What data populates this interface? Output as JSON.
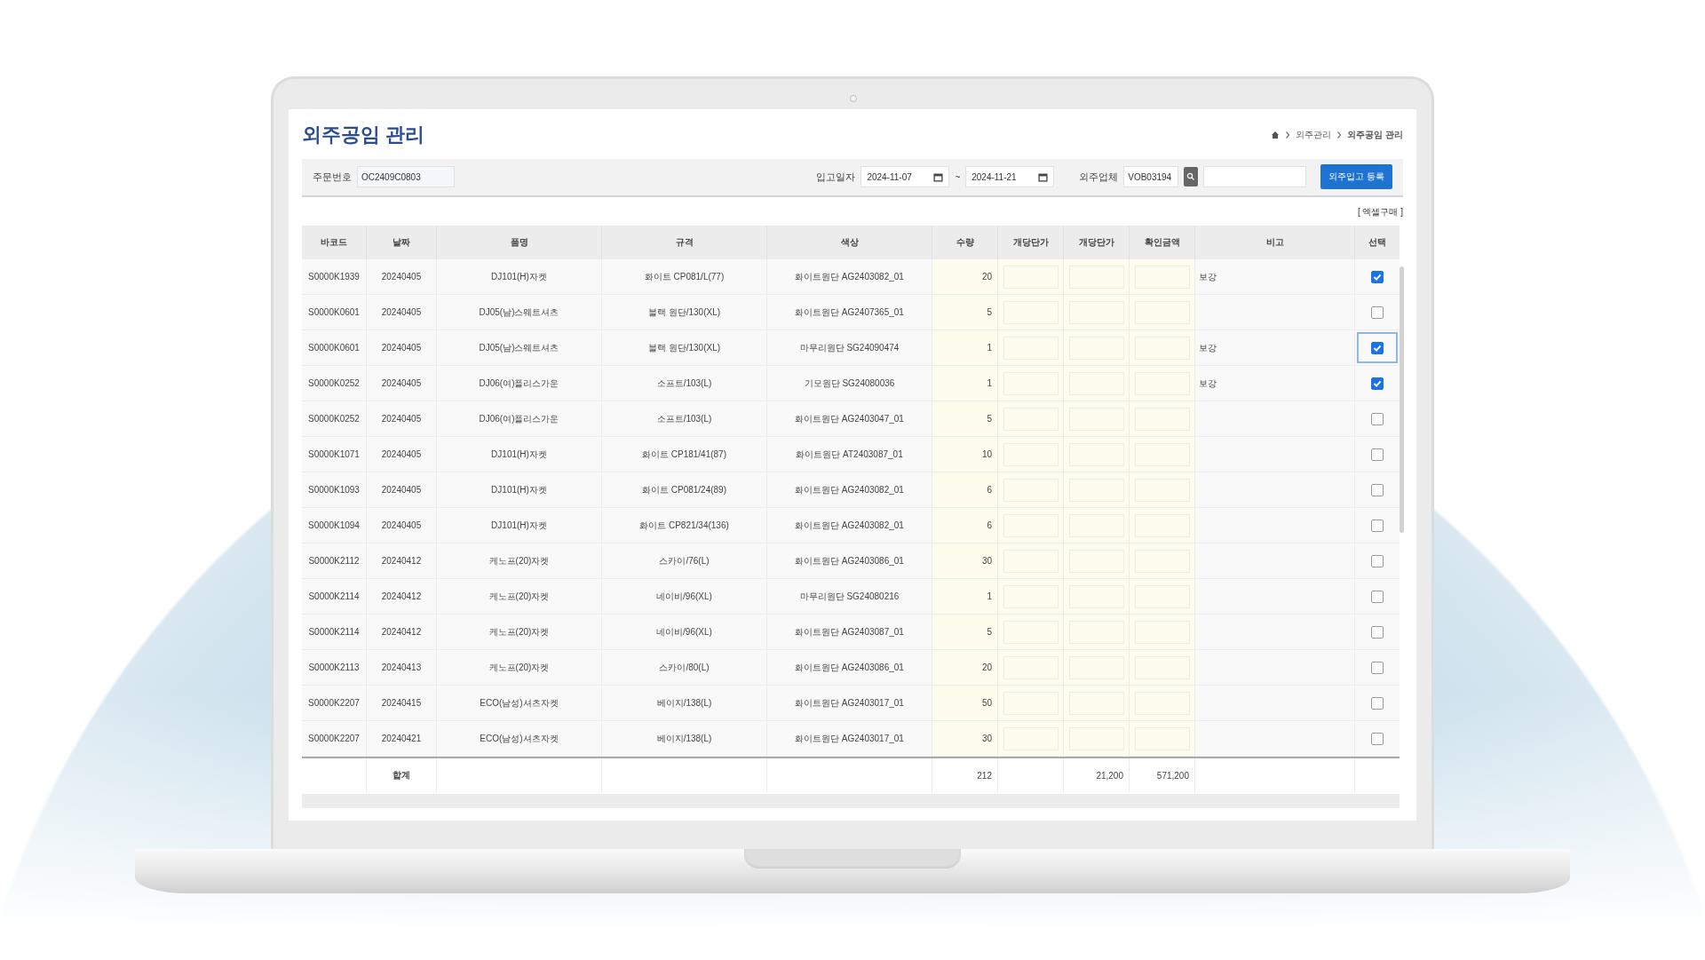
{
  "page": {
    "title": "외주공임 관리",
    "breadcrumb": [
      "외주관리",
      "외주공임 관리"
    ]
  },
  "filters": {
    "order_label": "주문번호",
    "order_value": "OC2409C0803",
    "date_label": "입고일자",
    "date_from": "2024-11-07",
    "date_separator": "~",
    "date_to": "2024-11-21",
    "vendor_label": "외주업체",
    "vendor_code": "VOB03194",
    "submit": "외주입고 등록"
  },
  "excel_link": "[ 엑셀구매 ]",
  "table": {
    "columns": [
      "바코드",
      "날짜",
      "품명",
      "규격",
      "색상",
      "수량",
      "개당단가",
      "개당단가",
      "확인금액",
      "비고",
      "선택"
    ],
    "rows": [
      {
        "barcode": "S0000K1939",
        "date": "20240405",
        "item": "DJ101(H)자켓",
        "spec": "화이트 CP081/L(77)",
        "color_name": "화이트원단 AG2403082_01",
        "qty": "20",
        "note": "보강",
        "checked": true,
        "focused": false
      },
      {
        "barcode": "S0000K0601",
        "date": "20240405",
        "item": "DJ05(남)스웨트셔츠",
        "spec": "블랙 원단/130(XL)",
        "color_name": "화이트원단 AG2407365_01",
        "qty": "5",
        "note": "",
        "checked": false,
        "focused": false
      },
      {
        "barcode": "S0000K0601",
        "date": "20240405",
        "item": "DJ05(남)스웨트셔츠",
        "spec": "블랙 원단/130(XL)",
        "color_name": "마무리원단 SG24090474",
        "qty": "1",
        "note": "보강",
        "checked": true,
        "focused": true
      },
      {
        "barcode": "S0000K0252",
        "date": "20240405",
        "item": "DJ06(여)플리스가운",
        "spec": "소프트/103(L)",
        "color_name": "기모원단 SG24080036",
        "qty": "1",
        "note": "보강",
        "checked": true,
        "focused": false
      },
      {
        "barcode": "S0000K0252",
        "date": "20240405",
        "item": "DJ06(여)플리스가운",
        "spec": "소프트/103(L)",
        "color_name": "화이트원단 AG2403047_01",
        "qty": "5",
        "note": "",
        "checked": false,
        "focused": false
      },
      {
        "barcode": "S0000K1071",
        "date": "20240405",
        "item": "DJ101(H)자켓",
        "spec": "화이트 CP181/41(87)",
        "color_name": "화이트원단 AT2403087_01",
        "qty": "10",
        "note": "",
        "checked": false,
        "focused": false
      },
      {
        "barcode": "S0000K1093",
        "date": "20240405",
        "item": "DJ101(H)자켓",
        "spec": "화이트 CP081/24(89)",
        "color_name": "화이트원단 AG2403082_01",
        "qty": "6",
        "note": "",
        "checked": false,
        "focused": false
      },
      {
        "barcode": "S0000K1094",
        "date": "20240405",
        "item": "DJ101(H)자켓",
        "spec": "화이트 CP821/34(136)",
        "color_name": "화이트원단 AG2403082_01",
        "qty": "6",
        "note": "",
        "checked": false,
        "focused": false
      },
      {
        "barcode": "S0000K2112",
        "date": "20240412",
        "item": "케노프(20)자켓",
        "spec": "스카이/76(L)",
        "color_name": "화이트원단 AG2403086_01",
        "qty": "30",
        "note": "",
        "checked": false,
        "focused": false
      },
      {
        "barcode": "S0000K2114",
        "date": "20240412",
        "item": "케노프(20)자켓",
        "spec": "네이비/96(XL)",
        "color_name": "마무리원단 SG24080216",
        "qty": "1",
        "note": "",
        "checked": false,
        "focused": false
      },
      {
        "barcode": "S0000K2114",
        "date": "20240412",
        "item": "케노프(20)자켓",
        "spec": "네이비/96(XL)",
        "color_name": "화이트원단 AG2403087_01",
        "qty": "5",
        "note": "",
        "checked": false,
        "focused": false
      },
      {
        "barcode": "S0000K2113",
        "date": "20240413",
        "item": "케노프(20)자켓",
        "spec": "스카이/80(L)",
        "color_name": "화이트원단 AG2403086_01",
        "qty": "20",
        "note": "",
        "checked": false,
        "focused": false
      },
      {
        "barcode": "S0000K2207",
        "date": "20240415",
        "item": "ECO(남성)셔츠자켓",
        "spec": "베이지/138(L)",
        "color_name": "화이트원단 AG2403017_01",
        "qty": "50",
        "note": "",
        "checked": false,
        "focused": false
      },
      {
        "barcode": "S0000K2207",
        "date": "20240421",
        "item": "ECO(남성)셔츠자켓",
        "spec": "베이지/138(L)",
        "color_name": "화이트원단 AG2403017_01",
        "qty": "30",
        "note": "",
        "checked": false,
        "focused": false
      }
    ],
    "total": {
      "label": "합계",
      "qty": "212",
      "unit_price": "21,200",
      "amount": "571,200"
    }
  }
}
